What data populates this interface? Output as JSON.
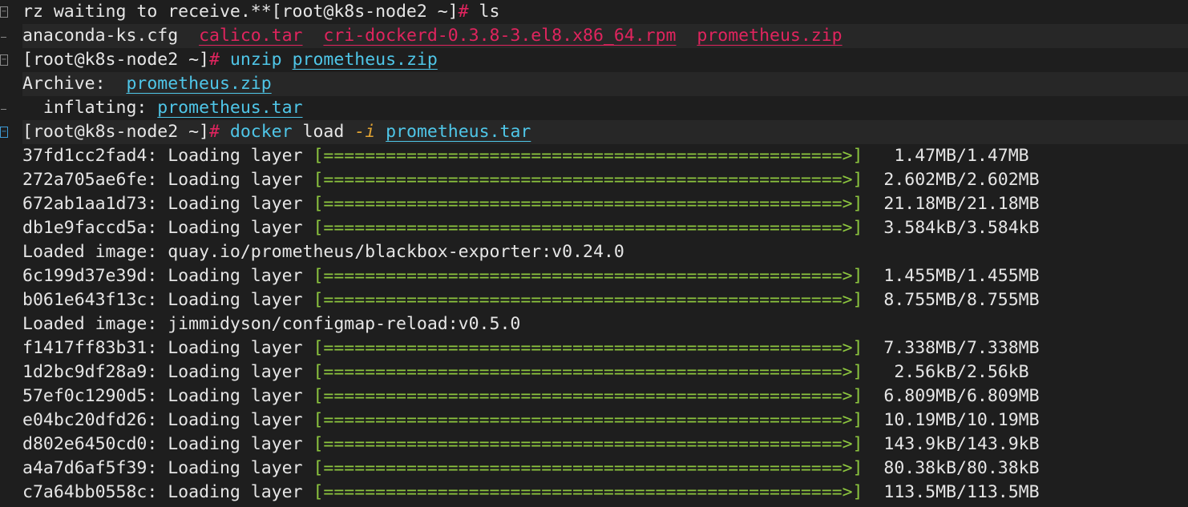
{
  "terminal": {
    "line1": {
      "text": "rz waiting to receive.**[root@k8s-node2 ~]",
      "hash": "#",
      "cmd": " ls"
    },
    "ls_output": {
      "file1": "anaconda-ks.cfg",
      "file2": "calico.tar",
      "file3": "cri-dockerd-0.3.8-3.el8.x86_64.rpm",
      "file4": "prometheus.zip"
    },
    "unzip_line": {
      "prompt": "[root@k8s-node2 ~]",
      "hash": "#",
      "cmd": "unzip",
      "arg": "prometheus.zip"
    },
    "archive_line": {
      "label": "Archive:",
      "value": "prometheus.zip"
    },
    "inflating_line": {
      "label": "  inflating:",
      "value": "prometheus.tar"
    },
    "docker_line": {
      "prompt": "[root@k8s-node2 ~]",
      "hash": "#",
      "cmd": "docker",
      "sub": "load",
      "flag": "-i",
      "arg": "prometheus.tar"
    },
    "loading_label": "Loading layer",
    "loaded_label": "Loaded image:",
    "progress_bar": "[==================================================>]",
    "layers": [
      {
        "id": "37fd1cc2fad4",
        "size": " 1.47MB/1.47MB"
      },
      {
        "id": "272a705ae6fe",
        "size": "2.602MB/2.602MB"
      },
      {
        "id": "672ab1aa1d73",
        "size": "21.18MB/21.18MB"
      },
      {
        "id": "db1e9faccd5a",
        "size": "3.584kB/3.584kB"
      }
    ],
    "loaded_image_1": "quay.io/prometheus/blackbox-exporter:v0.24.0",
    "layers2": [
      {
        "id": "6c199d37e39d",
        "size": "1.455MB/1.455MB"
      },
      {
        "id": "b061e643f13c",
        "size": "8.755MB/8.755MB"
      }
    ],
    "loaded_image_2": "jimmidyson/configmap-reload:v0.5.0",
    "layers3": [
      {
        "id": "f1417ff83b31",
        "size": "7.338MB/7.338MB"
      },
      {
        "id": "1d2bc9df28a9",
        "size": " 2.56kB/2.56kB"
      },
      {
        "id": "57ef0c1290d5",
        "size": "6.809MB/6.809MB"
      },
      {
        "id": "e04bc20dfd26",
        "size": "10.19MB/10.19MB"
      },
      {
        "id": "d802e6450cd0",
        "size": "143.9kB/143.9kB"
      },
      {
        "id": "a4a7d6af5f39",
        "size": "80.38kB/80.38kB"
      },
      {
        "id": "c7a64bb0558c",
        "size": "113.5MB/113.5MB"
      }
    ]
  },
  "colors": {
    "background": "#1e1e1e",
    "text": "#e6e6e6",
    "link_cyan": "#4fc6e8",
    "link_red": "#e0245e",
    "progress_green": "#8dc63f",
    "flag_orange": "#e3a432"
  },
  "icons": [
    "fold-collapse-icon"
  ]
}
